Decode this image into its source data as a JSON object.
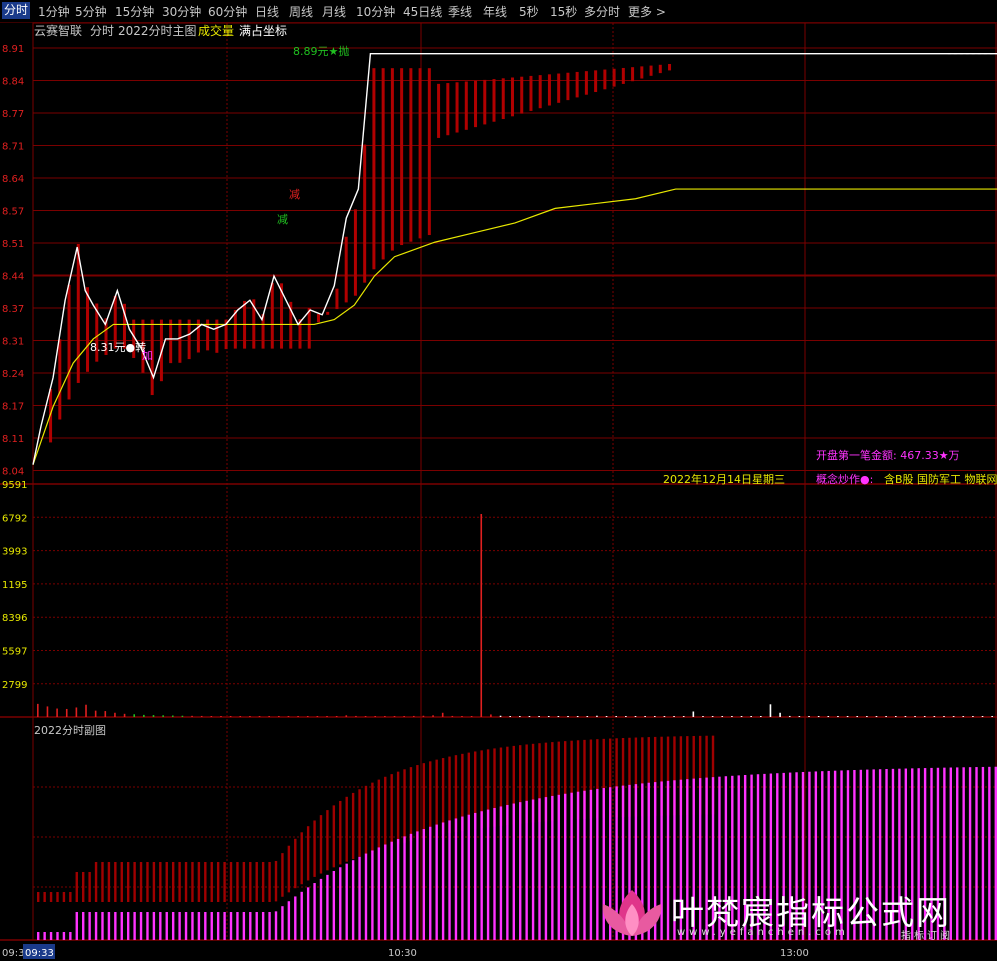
{
  "toolbar": {
    "tabs": [
      "分时",
      "1分钟",
      "5分钟",
      "15分钟",
      "30分钟",
      "60分钟",
      "日线",
      "周线",
      "月线",
      "10分钟",
      "45日线",
      "季线",
      "年线",
      "5秒",
      "15秒",
      "多分时",
      "更多"
    ],
    "active": "分时"
  },
  "header": {
    "stock_name": "云赛智联",
    "items": [
      "分时",
      "2022分时主图"
    ],
    "volume_label": "成交量",
    "full_coord": "满占坐标"
  },
  "price_axis": [
    "8.91",
    "8.84",
    "8.77",
    "8.71",
    "8.64",
    "8.57",
    "8.51",
    "8.44",
    "8.37",
    "8.31",
    "8.24",
    "8.17",
    "8.11",
    "8.04"
  ],
  "volume_axis": [
    "9591",
    "6792",
    "3993",
    "1195",
    "8396",
    "5597",
    "2799"
  ],
  "sub_panel_title": "2022分时副图",
  "time_axis": {
    "start": "09:30",
    "cursor": "09:33",
    "mid": "10:30",
    "afternoon": "13:00"
  },
  "annotations": {
    "high_label": "8.89元★抛",
    "low_label": "8.31元●转",
    "add_label": "加",
    "reduce_label_1": "减",
    "reduce_label_2": "减",
    "date": "2022年12月14日星期三",
    "open_amount": "开盘第一笔金额: 467.33★万",
    "concept_prefix": "概念炒作●:",
    "concept_values": "含B股 国防军工 物联网"
  },
  "watermark": {
    "title": "叶梵宸指标公式网",
    "url": "www.yefanchen.com",
    "sub": "指标订阅"
  },
  "colors": {
    "price_line": "#ffffff",
    "avg_line": "#e8e800",
    "band": "#b00000",
    "volume_up": "#e02020",
    "volume_down": "#20c020",
    "volume_flat": "#ffffff",
    "sub_upper": "#a00000",
    "sub_lower": "#ff33ff",
    "grid": "#7a0000"
  },
  "chart_data": {
    "type": "line",
    "title": "云赛智联 分时",
    "xlabel": "",
    "ylabel": "",
    "ylim": [
      8.0,
      8.91
    ],
    "x_ticks": [
      "09:30",
      "10:30",
      "13:00"
    ],
    "series": [
      {
        "name": "price",
        "x_minutes": [
          0,
          2,
          5,
          8,
          11,
          13,
          15,
          18,
          21,
          24,
          27,
          30,
          33,
          36,
          39,
          42,
          45,
          48,
          51,
          54,
          57,
          60,
          63,
          66,
          69,
          72,
          75,
          78,
          81,
          84,
          87,
          90,
          95,
          100,
          110,
          120,
          130,
          140,
          150,
          160,
          170,
          180,
          190,
          200,
          210,
          220,
          230,
          240
        ],
        "values": [
          8.04,
          8.12,
          8.22,
          8.38,
          8.49,
          8.4,
          8.37,
          8.33,
          8.4,
          8.32,
          8.28,
          8.22,
          8.3,
          8.3,
          8.31,
          8.33,
          8.32,
          8.33,
          8.36,
          8.38,
          8.34,
          8.43,
          8.38,
          8.33,
          8.36,
          8.35,
          8.41,
          8.55,
          8.61,
          8.89,
          8.89,
          8.89,
          8.89,
          8.89,
          8.89,
          8.89,
          8.89,
          8.89,
          8.89,
          8.89,
          8.89,
          8.89,
          8.89,
          8.89,
          8.89,
          8.89,
          8.89,
          8.89
        ]
      },
      {
        "name": "avg",
        "x_minutes": [
          0,
          5,
          10,
          15,
          20,
          30,
          40,
          50,
          60,
          70,
          75,
          80,
          85,
          90,
          100,
          110,
          120,
          130,
          140,
          150,
          160,
          170,
          180,
          190,
          200,
          210,
          220,
          230,
          240
        ],
        "values": [
          8.04,
          8.16,
          8.25,
          8.3,
          8.33,
          8.33,
          8.33,
          8.33,
          8.33,
          8.33,
          8.34,
          8.37,
          8.43,
          8.47,
          8.5,
          8.52,
          8.54,
          8.57,
          8.58,
          8.59,
          8.61,
          8.61,
          8.61,
          8.61,
          8.61,
          8.61,
          8.61,
          8.61,
          8.61
        ]
      }
    ],
    "volume": [
      620,
      500,
      400,
      380,
      450,
      580,
      300,
      280,
      200,
      150,
      130,
      100,
      90,
      80,
      70,
      60,
      55,
      50,
      40,
      35,
      30,
      28,
      25,
      20,
      18,
      16,
      14,
      12,
      10,
      9,
      8,
      7,
      80,
      50,
      40,
      30,
      35,
      40,
      45,
      50,
      60,
      80,
      200,
      50,
      40,
      30,
      9591,
      120,
      60,
      40,
      30,
      25,
      20,
      18,
      15,
      14,
      12,
      10,
      60,
      40,
      30,
      25,
      20,
      18,
      15,
      14,
      12,
      10,
      260,
      30,
      20,
      18,
      15,
      14,
      12,
      10,
      600,
      200,
      50,
      30,
      20,
      15,
      12,
      10,
      8,
      7,
      6,
      5,
      4,
      3,
      3,
      3,
      2,
      2,
      2,
      2,
      2,
      2,
      2,
      2
    ]
  }
}
